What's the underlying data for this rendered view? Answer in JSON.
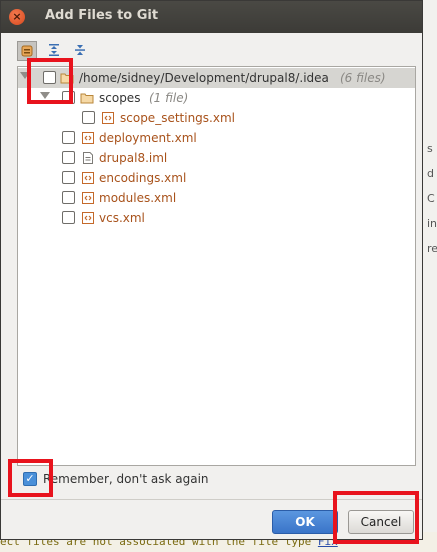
{
  "dialog": {
    "title": "Add Files to Git",
    "close_glyph": "×"
  },
  "toolbar": [
    {
      "name": "group-by-directory-icon"
    },
    {
      "name": "expand-all-icon"
    },
    {
      "name": "collapse-all-icon"
    }
  ],
  "tree": {
    "root": {
      "label": "/home/sidney/Development/drupal8/.idea",
      "count": "(6 files)"
    },
    "scopes": {
      "label": "scopes",
      "count": "(1 file)"
    },
    "files": [
      {
        "label": "scope_settings.xml",
        "type": "xml"
      },
      {
        "label": "deployment.xml",
        "type": "xml"
      },
      {
        "label": "drupal8.iml",
        "type": "iml"
      },
      {
        "label": "encodings.xml",
        "type": "xml"
      },
      {
        "label": "modules.xml",
        "type": "xml"
      },
      {
        "label": "vcs.xml",
        "type": "xml"
      }
    ]
  },
  "remember": {
    "label": "Remember, don't ask again",
    "checked": true,
    "check_glyph": "✓"
  },
  "buttons": {
    "ok": "OK",
    "cancel": "Cancel"
  },
  "background": {
    "right_chars": [
      "s",
      "d",
      "C",
      "in",
      "re"
    ],
    "bottom_text": "ect files are not associated with the file type",
    "bottom_link": "Fix"
  },
  "colors": {
    "highlight": "#e8131d",
    "ok_button": "#3a74c8",
    "xml_text": "#a8521b"
  }
}
